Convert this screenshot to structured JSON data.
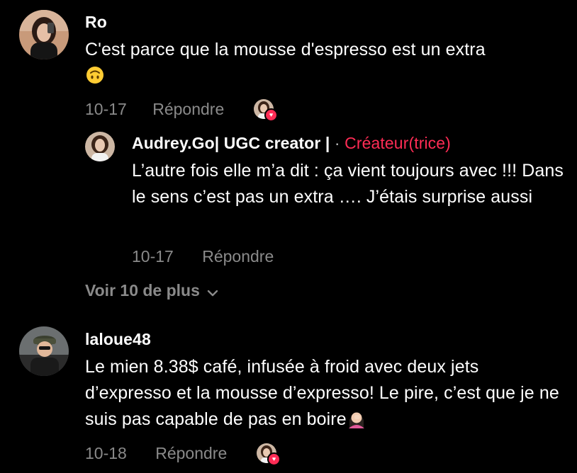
{
  "comments": [
    {
      "username": "Ro",
      "text": "C'est parce que la mousse d'espresso est un extra",
      "emoji": "upside-down-face",
      "date": "10-17",
      "reply_label": "Répondre"
    },
    {
      "username": "laloue48",
      "text": "Le mien 8.38$ café, infusée à froid avec deux jets d’expresso et la mousse d’expresso! Le pire, c’est que je ne suis pas capable de pas en boire",
      "emoji": "woman-facepalming",
      "date": "10-18",
      "reply_label": "Répondre"
    }
  ],
  "reply": {
    "username": "Audrey.Go| UGC creator |",
    "separator": "·",
    "creator_tag": "Créateur(trice)",
    "text": "L’autre fois elle m’a dit : ça vient toujours avec !!! Dans le sens c’est pas un extra …. J’étais surprise aussi",
    "date": "10-17",
    "reply_label": "Répondre"
  },
  "view_more": {
    "label": "Voir 10 de plus",
    "icon": "chevron-down-icon"
  },
  "colors": {
    "background": "#000000",
    "text": "#ffffff",
    "muted": "#8a8a8a",
    "creator": "#ff2c55"
  }
}
